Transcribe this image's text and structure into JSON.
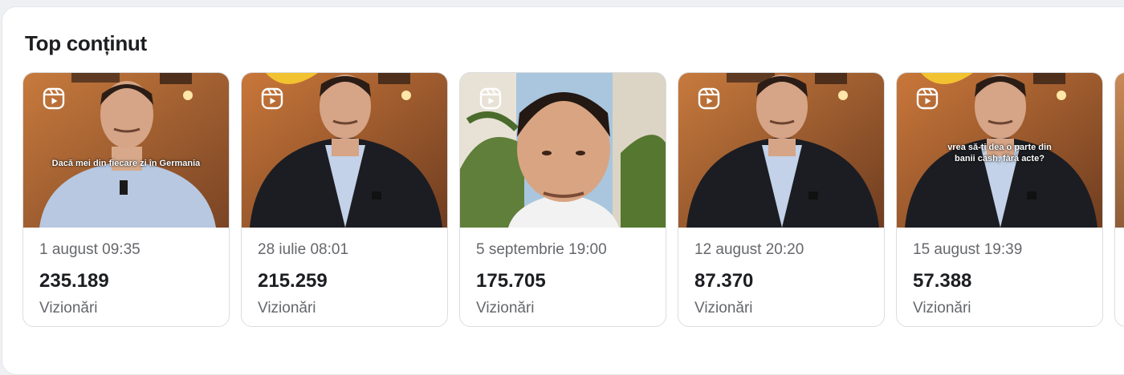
{
  "section": {
    "title": "Top conținut"
  },
  "cards": [
    {
      "date": "1 august 09:35",
      "views": "235.189",
      "views_label": "Vizionări",
      "caption": "Dacă mei din fiecare zi în Germania",
      "icon": "reels-icon"
    },
    {
      "date": "28 iulie 08:01",
      "views": "215.259",
      "views_label": "Vizionări",
      "caption": "",
      "icon": "reels-icon"
    },
    {
      "date": "5 septembrie 19:00",
      "views": "175.705",
      "views_label": "Vizionări",
      "caption": "",
      "icon": "reels-icon"
    },
    {
      "date": "12 august 20:20",
      "views": "87.370",
      "views_label": "Vizionări",
      "caption": "",
      "icon": "reels-icon"
    },
    {
      "date": "15 august 19:39",
      "views": "57.388",
      "views_label": "Vizionări",
      "caption": "vrea să-ți dea o parte din banii cash, fără acte?",
      "icon": "reels-icon"
    }
  ]
}
